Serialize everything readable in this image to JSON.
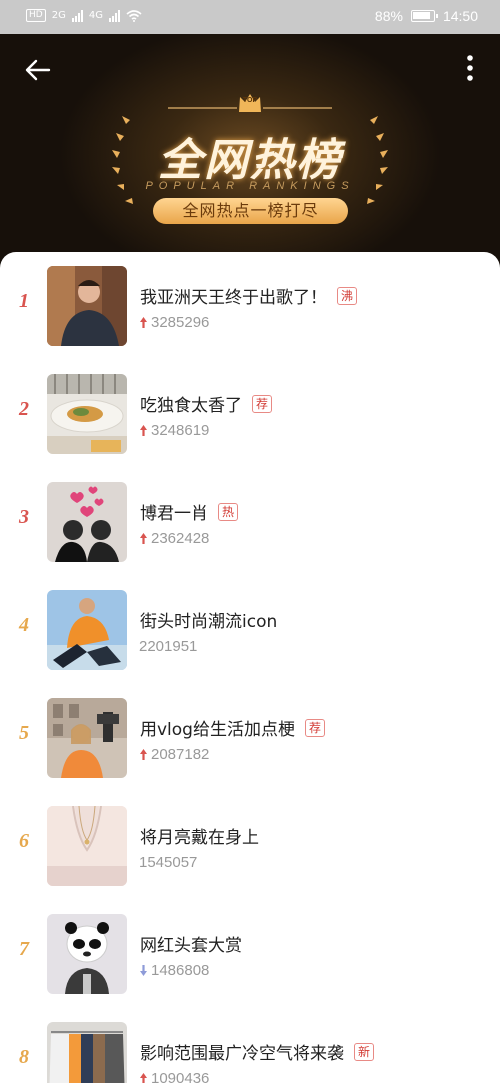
{
  "status_bar": {
    "left_badge": "HD",
    "net1": "2G",
    "net2": "4G",
    "battery": "88%",
    "time": "14:50"
  },
  "header": {
    "title": "全网热榜",
    "subtitle": "POPULAR RANKINGS",
    "slogan": "全网热点一榜打尽",
    "top_badge": "TOP"
  },
  "colors": {
    "rank_red": "#d9544f",
    "rank_orange": "#e6a84d",
    "tag_red": "#d23b34",
    "up_arrow": "#d9544f",
    "down_arrow": "#8e9bd8"
  },
  "items": [
    {
      "rank": "1",
      "title": "我亚洲天王终于出歌了！",
      "tag": "沸",
      "count": "3285296",
      "trend": "up"
    },
    {
      "rank": "2",
      "title": "吃独食太香了",
      "tag": "荐",
      "count": "3248619",
      "trend": "up"
    },
    {
      "rank": "3",
      "title": "博君一肖",
      "tag": "热",
      "count": "2362428",
      "trend": "up"
    },
    {
      "rank": "4",
      "title": "街头时尚潮流icon",
      "tag": "",
      "count": "2201951",
      "trend": "none"
    },
    {
      "rank": "5",
      "title": "用vlog给生活加点梗",
      "tag": "荐",
      "count": "2087182",
      "trend": "up"
    },
    {
      "rank": "6",
      "title": "将月亮戴在身上",
      "tag": "",
      "count": "1545057",
      "trend": "none"
    },
    {
      "rank": "7",
      "title": "网红头套大赏",
      "tag": "",
      "count": "1486808",
      "trend": "down"
    },
    {
      "rank": "8",
      "title": "影响范围最广冷空气将来袭",
      "tag": "新",
      "count": "1090436",
      "trend": "up"
    }
  ]
}
